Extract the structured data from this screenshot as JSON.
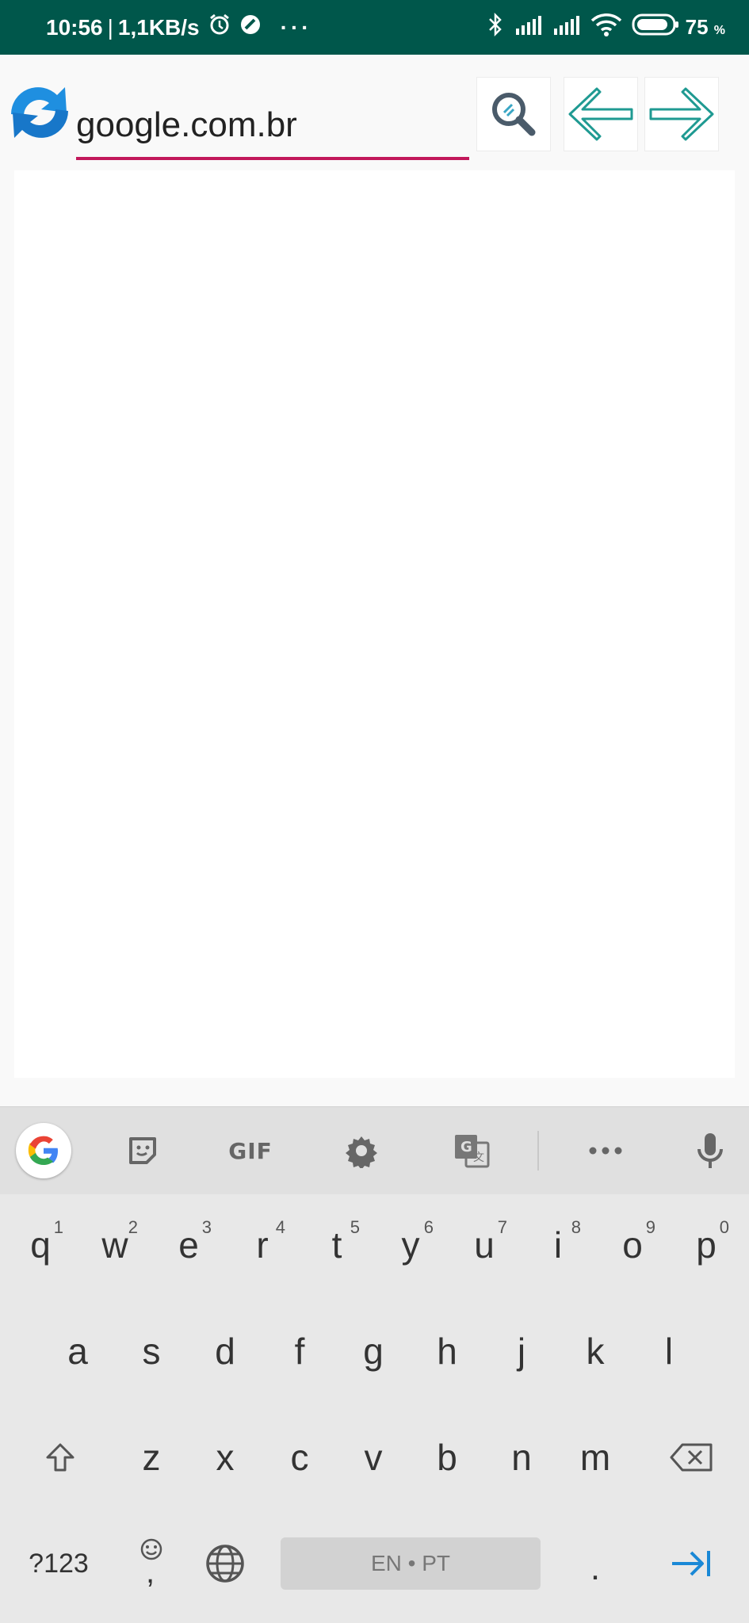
{
  "status_bar": {
    "time": "10:56",
    "speed": "1,1KB/s",
    "battery_percent": "75",
    "battery_symbol": "%",
    "icons": [
      "alarm-icon",
      "do-not-disturb-icon",
      "more-dots-icon",
      "bluetooth-icon",
      "signal-icon",
      "signal-icon",
      "wifi-icon",
      "battery-icon"
    ]
  },
  "browser": {
    "url_value": "google.com.br",
    "buttons": [
      "refresh",
      "search",
      "back",
      "forward"
    ]
  },
  "keyboard": {
    "toolbar": {
      "gif_label": "GIF",
      "icons": [
        "google-icon",
        "sticker-icon",
        "gif",
        "settings-icon",
        "translate-icon",
        "more-icon",
        "mic-icon"
      ]
    },
    "row1": [
      {
        "label": "q",
        "sup": "1"
      },
      {
        "label": "w",
        "sup": "2"
      },
      {
        "label": "e",
        "sup": "3"
      },
      {
        "label": "r",
        "sup": "4"
      },
      {
        "label": "t",
        "sup": "5"
      },
      {
        "label": "y",
        "sup": "6"
      },
      {
        "label": "u",
        "sup": "7"
      },
      {
        "label": "i",
        "sup": "8"
      },
      {
        "label": "o",
        "sup": "9"
      },
      {
        "label": "p",
        "sup": "0"
      }
    ],
    "row2": [
      "a",
      "s",
      "d",
      "f",
      "g",
      "h",
      "j",
      "k",
      "l"
    ],
    "row3": [
      "z",
      "x",
      "c",
      "v",
      "b",
      "n",
      "m"
    ],
    "symbols_label": "?123",
    "comma_label": ",",
    "space_label": "EN • PT",
    "period_label": "."
  },
  "colors": {
    "status_bar": "#00574b",
    "accent_underline": "#c2185b",
    "enter_blue": "#1a88d6"
  }
}
